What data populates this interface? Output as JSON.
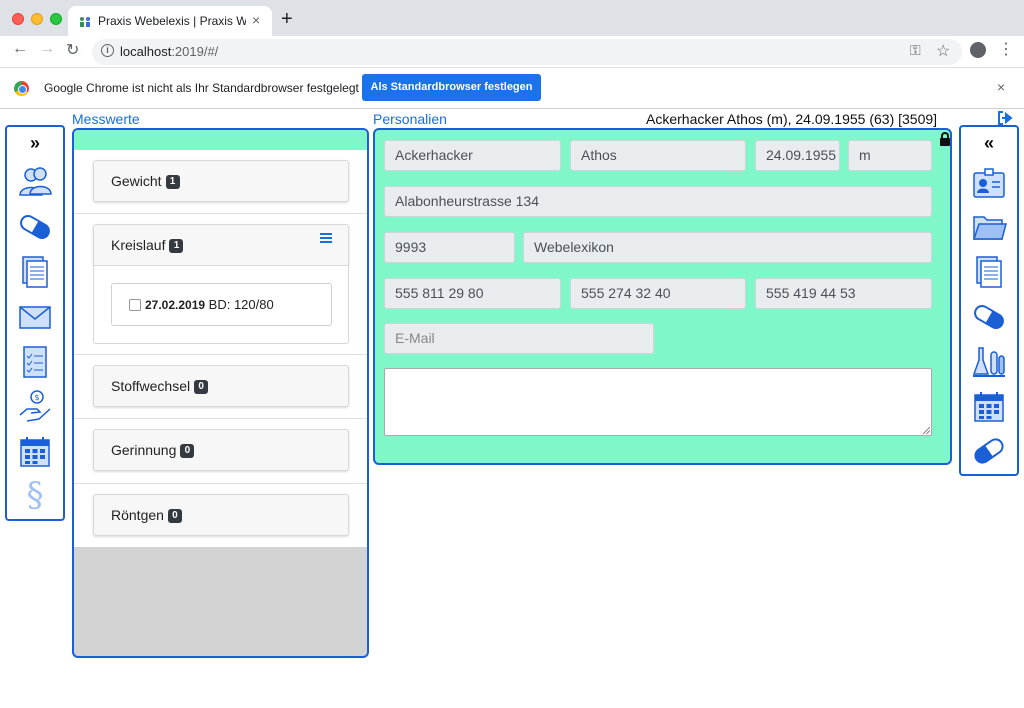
{
  "browser": {
    "tab_title": "Praxis Webelexis | Praxis Webelexis",
    "tab_close": "×",
    "new_tab": "+",
    "url_host": "localhost",
    "url_path": ":2019/#/",
    "back": "←",
    "forward": "→",
    "reload": "↻",
    "key": "⚿",
    "star": "☆",
    "menu": "⋮"
  },
  "infobar": {
    "message": "Google Chrome ist nicht als Ihr Standardbrowser festgelegt",
    "button_label": "Als Standardbrowser festlegen",
    "close": "×"
  },
  "app": {
    "left_toggle": "»",
    "right_toggle": "«",
    "left_icons": [
      "persons-icon",
      "pill-icon",
      "documents-icon",
      "mail-icon",
      "checklist-icon",
      "billing-hand-icon",
      "calendar-icon",
      "paragraph-icon"
    ],
    "right_icons": [
      "id-card-icon",
      "folder-icon",
      "documents-icon",
      "pill-icon",
      "lab-icon",
      "calendar-icon",
      "capsule-icon"
    ],
    "paragraph_glyph": "§",
    "messwerte_title": "Messwerte",
    "personalien_title": "Personalien",
    "patient_header": "Ackerhacker Athos (m), 24.09.1955 (63) [3509]",
    "colors": {
      "accent": "#1a5fd6",
      "mint": "#7ff7c9",
      "link": "#1a6fe0"
    }
  },
  "messwerte": {
    "groups": [
      {
        "label": "Gewicht",
        "count": "1"
      },
      {
        "label": "Kreislauf",
        "count": "1"
      },
      {
        "label": "Stoffwechsel",
        "count": "0"
      },
      {
        "label": "Gerinnung",
        "count": "0"
      },
      {
        "label": "Röntgen",
        "count": "0"
      }
    ],
    "kreislauf_entry": {
      "date": "27.02.2019",
      "value": " BD: 120/80"
    }
  },
  "personalien": {
    "lastname": "Ackerhacker",
    "firstname": "Athos",
    "birthdate": "24.09.1955",
    "sex": "m",
    "street": "Alabonheurstrasse 134",
    "zip": "9993",
    "city": "Webelexikon",
    "phone1": "555 811 29 80",
    "phone2": "555 274 32 40",
    "phone3": "555 419 44 53",
    "email_placeholder": "E-Mail",
    "remarks": ""
  }
}
